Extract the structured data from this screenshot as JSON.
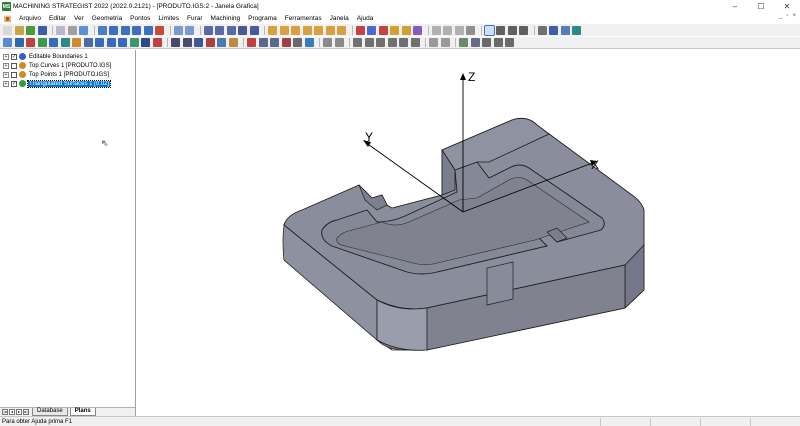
{
  "window": {
    "title": "MACHINING STRATEGIST 2022 (2022.0.2121) - [PRODUTO.IGS:2 - Janela Grafica]",
    "app_icon_text": "MS",
    "minimize": "–",
    "maximize": "☐",
    "close": "✕"
  },
  "menu": {
    "items": [
      "Arquivo",
      "Editar",
      "Ver",
      "Geometria",
      "Pontos",
      "Limites",
      "Furar",
      "Machining",
      "Programa",
      "Ferramentas",
      "Janela",
      "Ajuda"
    ],
    "mdi_min": "_",
    "mdi_restore": "▫",
    "mdi_close": "×"
  },
  "tree": {
    "expander": "+",
    "check": "✓",
    "items": [
      {
        "label": "Editable Boundaries 1",
        "icon_color": "#2a63c7"
      },
      {
        "label": "Top Curves 1 [PRODUTO.IGS]",
        "icon_color": "#d08a2a"
      },
      {
        "label": "Top Points 1 [PRODUTO.IGS]",
        "icon_color": "#d08a2a"
      },
      {
        "label": "Triangulated Surfaces 1 [0.02]",
        "icon_color": "#2e9e3a"
      }
    ]
  },
  "tabs": {
    "nav": [
      "|◂",
      "◂",
      "▸",
      "▸|"
    ],
    "items": [
      "Database",
      "Plans"
    ],
    "active": "Plans"
  },
  "viewport": {
    "axis_x": "X",
    "axis_y": "Y",
    "axis_z": "Z",
    "part_color": "#8a8d9c"
  },
  "status": {
    "text": "Para obter Ajuda prima F1"
  }
}
